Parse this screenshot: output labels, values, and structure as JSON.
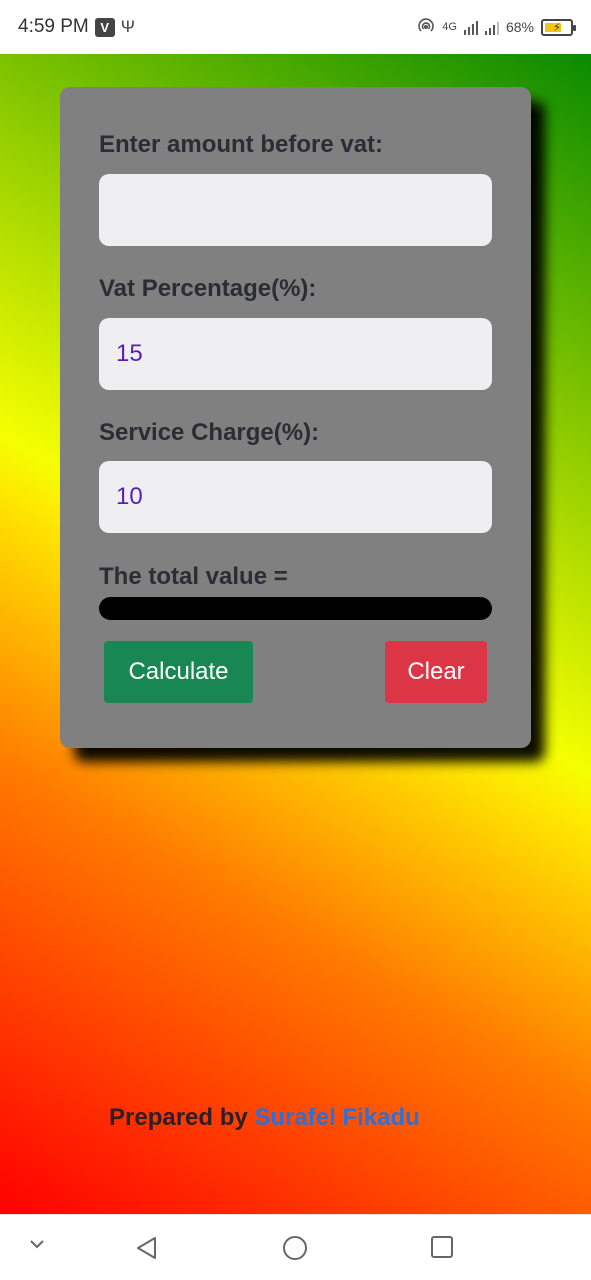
{
  "status_bar": {
    "time": "4:59 PM",
    "badge": "V",
    "usb_icon": "usb-icon",
    "network": "4G",
    "battery": "68%",
    "battery_level": 0.68
  },
  "form": {
    "amount_label": "Enter amount before vat:",
    "amount_value": "",
    "vat_label": "Vat Percentage(%):",
    "vat_value": "15",
    "service_label": "Service Charge(%):",
    "service_value": "10",
    "total_label": "The total value =",
    "calculate_label": "Calculate",
    "clear_label": "Clear"
  },
  "footer": {
    "prefix": "Prepared by",
    "author": "Surafel Fikadu"
  },
  "colors": {
    "calculate": "#198754",
    "clear": "#dc3545",
    "author_link": "#2f6fd6"
  }
}
